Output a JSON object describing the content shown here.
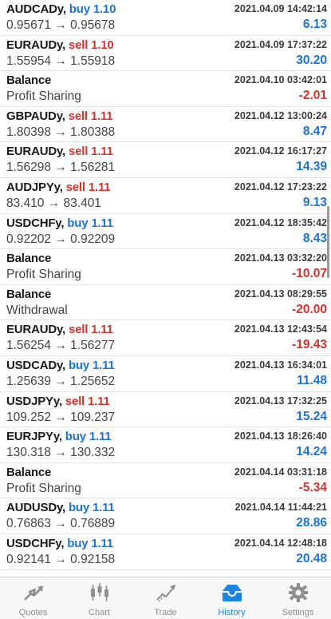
{
  "trades": [
    {
      "symbol": "AUDCADy",
      "action": "buy",
      "volume": "1.10",
      "detail": "0.95671 → 0.95678",
      "time": "2021.04.09 14:42:14",
      "profit": "6.13"
    },
    {
      "symbol": "EURAUDy",
      "action": "sell",
      "volume": "1.10",
      "detail": "1.55954 → 1.55918",
      "time": "2021.04.09 17:37:22",
      "profit": "30.20"
    },
    {
      "symbol": "Balance",
      "action": "",
      "volume": "",
      "detail": "Profit Sharing",
      "time": "2021.04.10 03:42:01",
      "profit": "-2.01"
    },
    {
      "symbol": "GBPAUDy",
      "action": "sell",
      "volume": "1.11",
      "detail": "1.80398 → 1.80388",
      "time": "2021.04.12 13:00:24",
      "profit": "8.47"
    },
    {
      "symbol": "EURAUDy",
      "action": "sell",
      "volume": "1.11",
      "detail": "1.56298 → 1.56281",
      "time": "2021.04.12 16:17:27",
      "profit": "14.39"
    },
    {
      "symbol": "AUDJPYy",
      "action": "sell",
      "volume": "1.11",
      "detail": "83.410 → 83.401",
      "time": "2021.04.12 17:23:22",
      "profit": "9.13"
    },
    {
      "symbol": "USDCHFy",
      "action": "buy",
      "volume": "1.11",
      "detail": "0.92202 → 0.92209",
      "time": "2021.04.12 18:35:42",
      "profit": "8.43"
    },
    {
      "symbol": "Balance",
      "action": "",
      "volume": "",
      "detail": "Profit Sharing",
      "time": "2021.04.13 03:32:20",
      "profit": "-10.07"
    },
    {
      "symbol": "Balance",
      "action": "",
      "volume": "",
      "detail": "Withdrawal",
      "time": "2021.04.13 08:29:55",
      "profit": "-20.00"
    },
    {
      "symbol": "EURAUDy",
      "action": "sell",
      "volume": "1.11",
      "detail": "1.56254 → 1.56277",
      "time": "2021.04.13 12:43:54",
      "profit": "-19.43"
    },
    {
      "symbol": "USDCADy",
      "action": "buy",
      "volume": "1.11",
      "detail": "1.25639 → 1.25652",
      "time": "2021.04.13 16:34:01",
      "profit": "11.48"
    },
    {
      "symbol": "USDJPYy",
      "action": "sell",
      "volume": "1.11",
      "detail": "109.252 → 109.237",
      "time": "2021.04.13 17:32:25",
      "profit": "15.24"
    },
    {
      "symbol": "EURJPYy",
      "action": "buy",
      "volume": "1.11",
      "detail": "130.318 → 130.332",
      "time": "2021.04.13 18:26:40",
      "profit": "14.24"
    },
    {
      "symbol": "Balance",
      "action": "",
      "volume": "",
      "detail": "Profit Sharing",
      "time": "2021.04.14 03:31:18",
      "profit": "-5.34"
    },
    {
      "symbol": "AUDUSDy",
      "action": "buy",
      "volume": "1.11",
      "detail": "0.76863 → 0.76889",
      "time": "2021.04.14 11:44:21",
      "profit": "28.86"
    },
    {
      "symbol": "USDCHFy",
      "action": "buy",
      "volume": "1.11",
      "detail": "0.92141 → 0.92158",
      "time": "2021.04.14 12:48:18",
      "profit": "20.48"
    }
  ],
  "tabs": [
    {
      "label": "Quotes",
      "icon": "quotes-icon",
      "active": false
    },
    {
      "label": "Chart",
      "icon": "chart-icon",
      "active": false
    },
    {
      "label": "Trade",
      "icon": "trade-icon",
      "active": false
    },
    {
      "label": "History",
      "icon": "history-icon",
      "active": true
    },
    {
      "label": "Settings",
      "icon": "settings-icon",
      "active": false
    }
  ],
  "colors": {
    "buy": "#1a73d9",
    "sell": "#d9322a",
    "active_tab": "#1b86e0",
    "inactive_tab": "#8e8e8e"
  }
}
